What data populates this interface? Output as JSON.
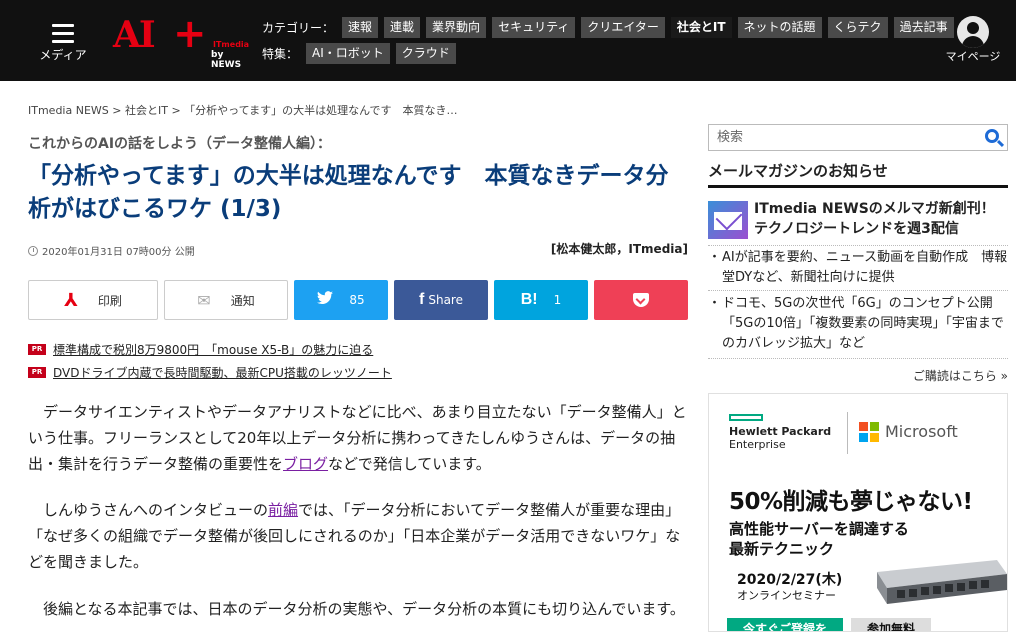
{
  "header": {
    "menu_label": "メディア",
    "logo_main": "AI",
    "logo_plus": "+",
    "logo_itmedia": "ITmedia",
    "logo_bynews": "by NEWS",
    "category_head": "カテゴリー：",
    "categories": [
      "速報",
      "連載",
      "業界動向",
      "セキュリティ",
      "クリエイター",
      "社会とIT",
      "ネットの話題",
      "くらテク",
      "過去記事"
    ],
    "active_category": "社会とIT",
    "feature_head": "特集：",
    "features": [
      "AI・ロボット",
      "クラウド"
    ],
    "mypage_label": "マイページ"
  },
  "breadcrumb": {
    "items": [
      "ITmedia NEWS",
      "社会とIT",
      "「分析やってます」の大半は処理なんです　本質なき…"
    ],
    "separator": ">"
  },
  "article": {
    "series": "これからのAIの話をしよう（データ整備人編）：",
    "title": "「分析やってます」の大半は処理なんです　本質なきデータ分析がはびこるワケ (1/3)",
    "date": "2020年01月31日 07時00分 公開",
    "author": "[松本健太郎，ITmedia]",
    "paragraphs": [
      {
        "before": "データサイエンティストやデータアナリストなどに比べ、あまり目立たない「データ整備人」という仕事。フリーランスとして20年以上データ分析に携わってきたしんゆうさんは、データの抽出・集計を行うデータ整備の重要性を",
        "link": "ブログ",
        "after": "などで発信しています。"
      },
      {
        "before": "しんゆうさんへのインタビューの",
        "link": "前編",
        "after": "では、「データ分析においてデータ整備人が重要な理由」「なぜ多くの組織でデータ整備が後回しにされるのか」「日本企業がデータ活用できないワケ」などを聞きました。"
      },
      {
        "before": "後編となる本記事では、日本のデータ分析の実態や、データ分析の本質にも切り込んでいます。",
        "link": "",
        "after": ""
      }
    ]
  },
  "share": {
    "print_label": "印刷",
    "notify_label": "通知",
    "twitter_count": "85",
    "facebook_label": "Share",
    "hatena_count": "1",
    "hatena_icon": "B!",
    "facebook_icon": "f",
    "twitter_icon": "bird-icon",
    "print_icon": "pdf-icon",
    "notify_icon": "notification-icon",
    "pocket_icon": "pocket-icon"
  },
  "pr": {
    "badge": "PR",
    "links": [
      "標準構成で税別8万9800円　「mouse X5-B」の魅力に迫る",
      "DVDドライブ内蔵で長時間駆動、最新CPU搭載のレッツノート"
    ]
  },
  "sidebar": {
    "search_placeholder": "検索",
    "mailmag_heading": "メールマガジンのお知らせ",
    "mailmag_feature": "ITmedia NEWSのメルマガ新創刊！ テクノロジートレンドを週3配信",
    "mailmag_items": [
      "AIが記事を要約、ニュース動画を自動作成　博報堂DYなど、新聞社向けに提供",
      "ドコモ、5Gの次世代「6G」のコンセプト公開　「5Gの10倍」「複数要素の同時実現」「宇宙までのカバレッジ拡大」など"
    ],
    "mailmag_more": "ご購読はこちら »"
  },
  "ad": {
    "hpe_line1": "Hewlett Packard",
    "hpe_line2": "Enterprise",
    "ms_text": "Microsoft",
    "headline": "50%削減も夢じゃない!",
    "sub1": "高性能サーバーを調達する",
    "sub2": "最新テクニック",
    "date": "2020/2/27(木)",
    "online": "オンラインセミナー",
    "cta1": "今すぐご登録を",
    "cta2": "参加無料"
  },
  "colors": {
    "header_bg": "#111111",
    "title": "#0a3d7a",
    "twitter": "#1da1f2",
    "facebook": "#3b5998",
    "hatena": "#00a4de",
    "pocket": "#ef4056",
    "pr_badge": "#c4001a",
    "link_visited": "#7a1fa2",
    "search_icon": "#1e6bd6",
    "hpe_green": "#01a982"
  }
}
